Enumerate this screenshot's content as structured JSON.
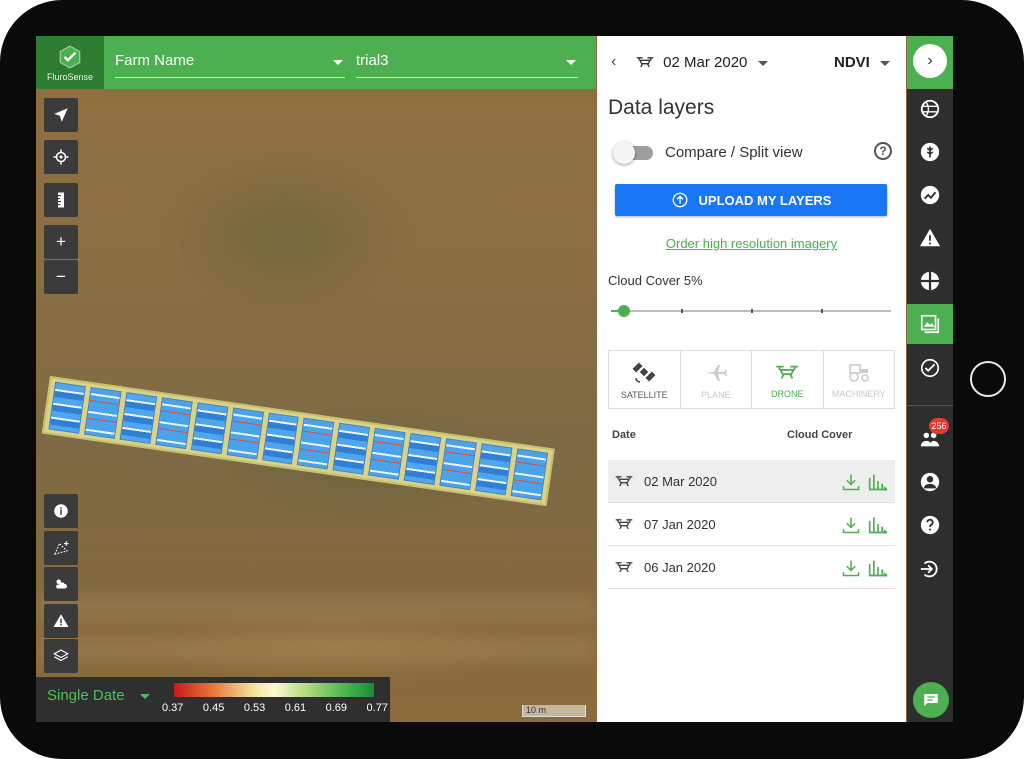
{
  "app": {
    "logo_text": "FluroSense",
    "brand_color": "#4caf50",
    "brand_dark": "#2e7d32"
  },
  "topbar": {
    "farm_select": "Farm Name",
    "field_select": "trial3"
  },
  "map": {
    "tools": [
      "location-arrow-icon",
      "crosshair-icon",
      "ruler-icon",
      "zoom-in-icon",
      "zoom-out-icon"
    ],
    "bottom_tools": [
      "info-icon",
      "measure-polygon-icon",
      "weather-icon",
      "warning-icon",
      "layers-icon"
    ],
    "zoom_in": "+",
    "zoom_out": "−",
    "legend": {
      "mode": "Single Date",
      "ticks": [
        "0.37",
        "0.45",
        "0.53",
        "0.61",
        "0.69",
        "0.77"
      ]
    },
    "scale": "10 m"
  },
  "panel": {
    "back": "‹",
    "date": "02 Mar 2020",
    "index": "NDVI",
    "title": "Data layers",
    "compare_label": "Compare / Split view",
    "help": "?",
    "upload_label": "UPLOAD MY LAYERS",
    "order_link": "Order high resolution imagery",
    "cloud_label": "Cloud Cover 5%",
    "cloud_cover_value": 0.05,
    "sources": [
      {
        "label": "SATELLITE",
        "state": "normal"
      },
      {
        "label": "PLANE",
        "state": "disabled"
      },
      {
        "label": "DRONE",
        "state": "active"
      },
      {
        "label": "MACHINERY",
        "state": "disabled"
      }
    ],
    "list_headers": {
      "date": "Date",
      "cloud": "Cloud Cover"
    },
    "rows": [
      {
        "date": "02 Mar 2020",
        "selected": true
      },
      {
        "date": "07 Jan 2020",
        "selected": false
      },
      {
        "date": "06 Jan 2020",
        "selected": false
      }
    ]
  },
  "rail": {
    "next": "›",
    "badge": "256",
    "icons": [
      "globe-icon",
      "crop-icon",
      "analytics-icon",
      "alert-icon",
      "zones-icon",
      "data-layers-icon",
      "check-analysis-icon",
      "team-icon",
      "profile-icon",
      "help-icon",
      "logout-icon",
      "chat-icon"
    ]
  }
}
